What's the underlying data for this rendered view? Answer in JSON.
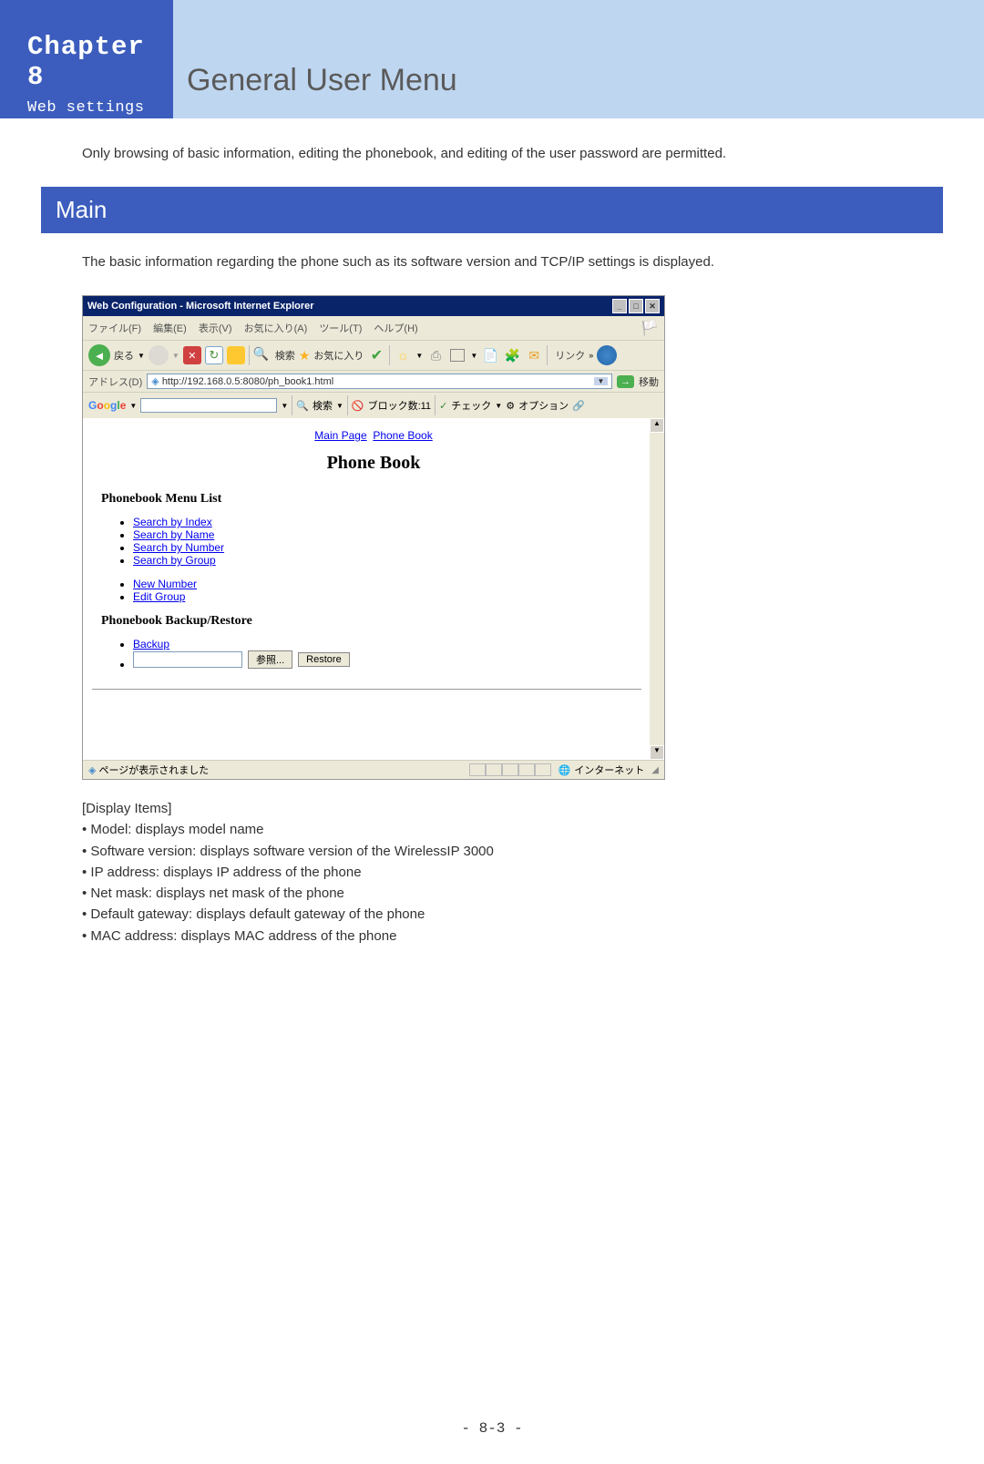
{
  "header": {
    "chapter": "Chapter 8",
    "subtitle": "Web settings",
    "menu_title": "General User Menu"
  },
  "intro": "Only browsing of basic information, editing the phonebook, and editing of the user password are permitted.",
  "section": {
    "title": "Main",
    "description": "The basic information regarding the phone such as its software version and TCP/IP settings is displayed."
  },
  "ie_window": {
    "title": "Web Configuration - Microsoft Internet Explorer",
    "menu": {
      "file": "ファイル(F)",
      "edit": "編集(E)",
      "view": "表示(V)",
      "favorites": "お気に入り(A)",
      "tools": "ツール(T)",
      "help": "ヘルプ(H)"
    },
    "toolbar": {
      "back": "戻る",
      "search": "検索",
      "favorites": "お気に入り",
      "links": "リンク"
    },
    "address": {
      "label": "アドレス(D)",
      "url": "http://192.168.0.5:8080/ph_book1.html",
      "go": "移動"
    },
    "google": {
      "search": "検索",
      "blocked": "ブロック数:11",
      "check": "チェック",
      "options": "オプション"
    },
    "content": {
      "nav_main": "Main Page",
      "nav_phone": "Phone Book",
      "title": "Phone Book",
      "menu_list_title": "Phonebook Menu List",
      "search_index": "Search by Index",
      "search_name": "Search by Name",
      "search_number": "Search by Number",
      "search_group": "Search by Group",
      "new_number": "New Number",
      "edit_group": "Edit Group",
      "backup_title": "Phonebook Backup/Restore",
      "backup": "Backup",
      "browse": "参照...",
      "restore": "Restore"
    },
    "status": {
      "text": "ページが表示されました",
      "zone": "インターネット"
    }
  },
  "display": {
    "heading": "[Display Items]",
    "items": [
      "• Model: displays model name",
      "• Software version: displays software version of the WirelessIP 3000",
      "• IP address: displays IP address of the phone",
      "• Net mask: displays net mask of the phone",
      "• Default gateway: displays default gateway of the phone",
      "• MAC address: displays MAC address of the phone"
    ]
  },
  "page_number": "- 8-3 -"
}
